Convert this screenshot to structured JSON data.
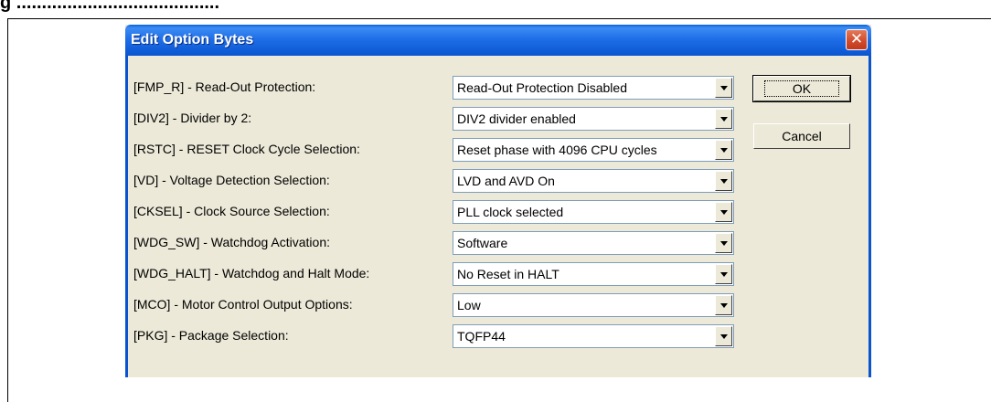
{
  "caption": "g ........................................",
  "dialog": {
    "title": "Edit Option Bytes",
    "close_glyph": "✕",
    "ok_label": "OK",
    "cancel_label": "Cancel",
    "rows": [
      {
        "label": "[FMP_R] - Read-Out Protection:",
        "value": "Read-Out Protection Disabled"
      },
      {
        "label": "[DIV2] - Divider by 2:",
        "value": "DIV2 divider enabled"
      },
      {
        "label": "[RSTC] - RESET Clock Cycle Selection:",
        "value": "Reset phase with 4096 CPU cycles"
      },
      {
        "label": "[VD] - Voltage Detection Selection:",
        "value": "LVD and AVD On"
      },
      {
        "label": "[CKSEL] - Clock Source Selection:",
        "value": "PLL clock selected"
      },
      {
        "label": "[WDG_SW] - Watchdog Activation:",
        "value": "Software"
      },
      {
        "label": "[WDG_HALT] - Watchdog and Halt Mode:",
        "value": "No Reset in HALT"
      },
      {
        "label": "[MCO] - Motor Control Output Options:",
        "value": "Low"
      },
      {
        "label": "[PKG] - Package Selection:",
        "value": "TQFP44"
      }
    ]
  }
}
